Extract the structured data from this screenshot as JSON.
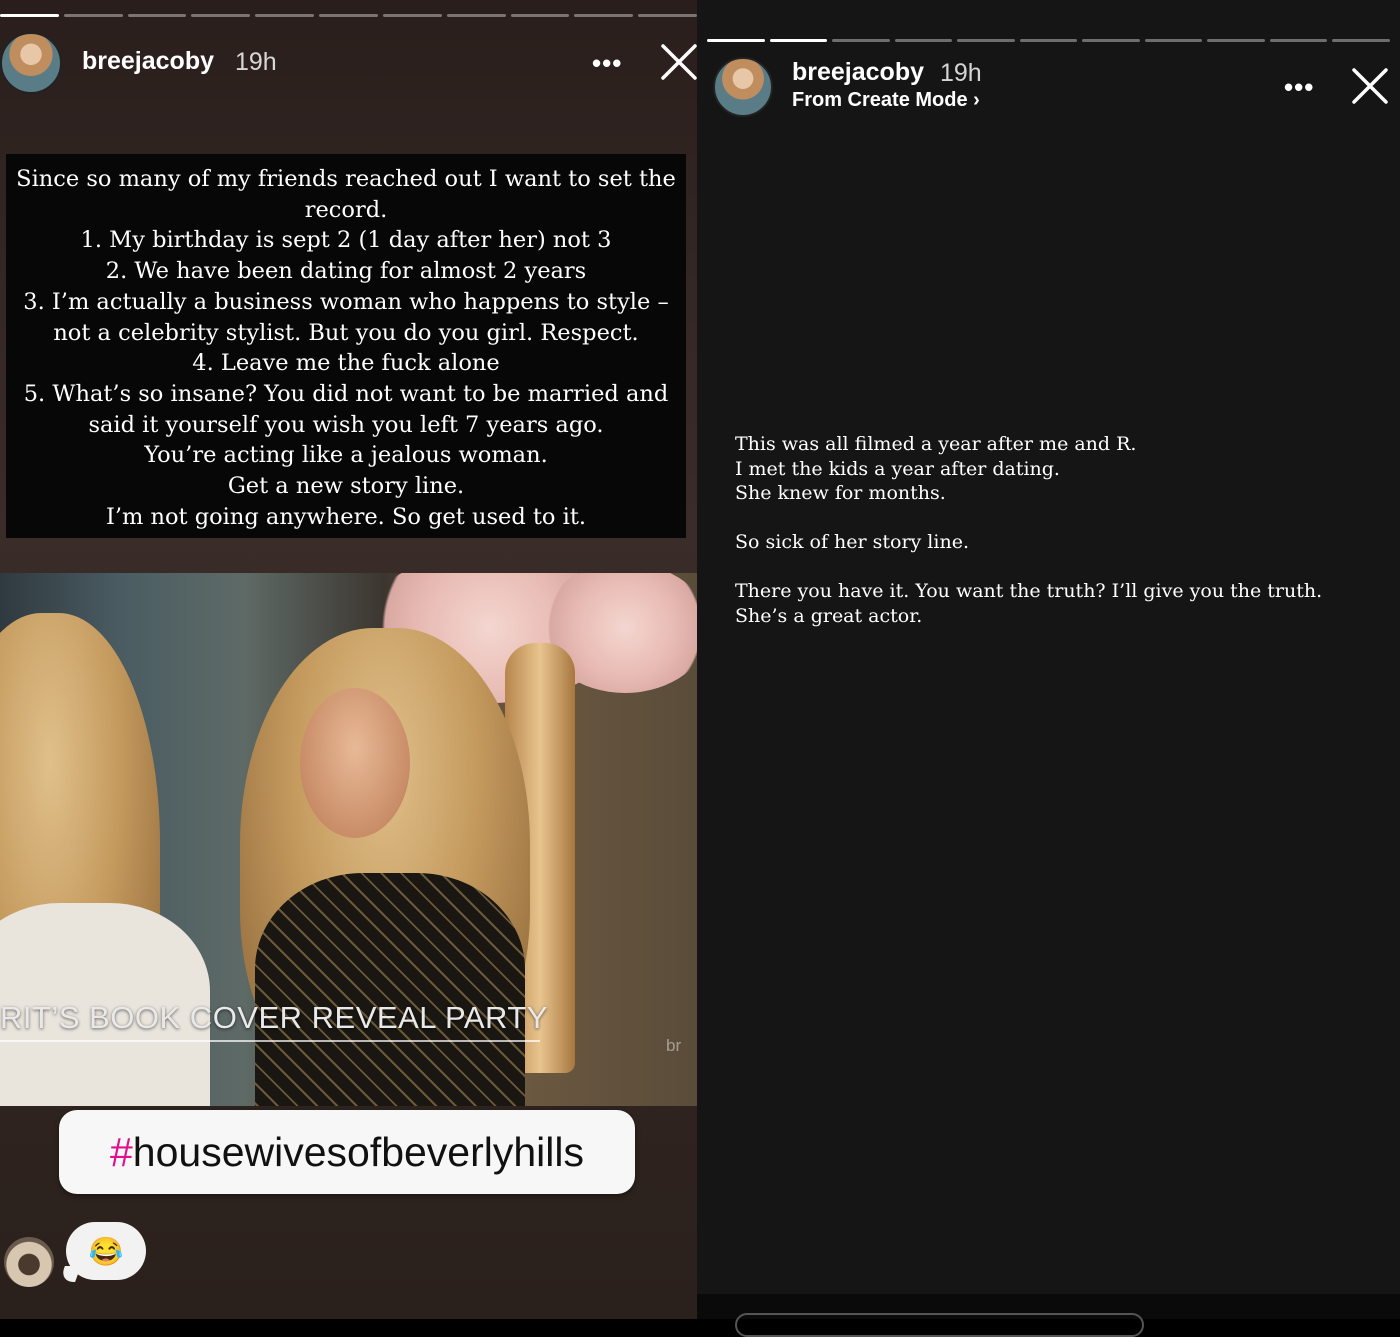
{
  "left_story": {
    "progress_segments_total": 11,
    "progress_segments_done": 1,
    "username": "breejacoby",
    "time": "19h",
    "more_label": "•••",
    "note_text": "Since so many of my friends reached out I want to set the record.\n1. My birthday is sept 2 (1 day after her) not 3\n2. We have been dating for almost 2 years\n3. I’m actually a business woman who happens to style – not a celebrity stylist. But you do you girl. Respect.\n4. Leave me the fuck alone\n5. What’s so insane? You did not want to be married and said it yourself you wish you left 7 years ago.\nYou’re acting like a jealous woman.\nGet a new story line.\nI’m not going anywhere. So get used to it.",
    "tv_caption": "RIT’S BOOK COVER REVEAL PARTY",
    "tv_bug": "br",
    "hashtag_symbol": "#",
    "hashtag_text": "housewivesofbeverlyhills",
    "reaction_emoji": "😂"
  },
  "right_story": {
    "progress_segments_total": 11,
    "progress_segments_done": 2,
    "username": "breejacoby",
    "time": "19h",
    "subtitle": "From Create Mode ›",
    "more_label": "•••",
    "text": "This was all filmed a year after me and R.\nI met the kids a year after dating.\nShe knew for months.\n\nSo sick of her story line.\n\nThere you have it. You want the truth? I’ll give you the truth. She’s a great actor."
  },
  "colors": {
    "hashtag_accent": "#e0118c",
    "story_right_bg": "#151515"
  }
}
